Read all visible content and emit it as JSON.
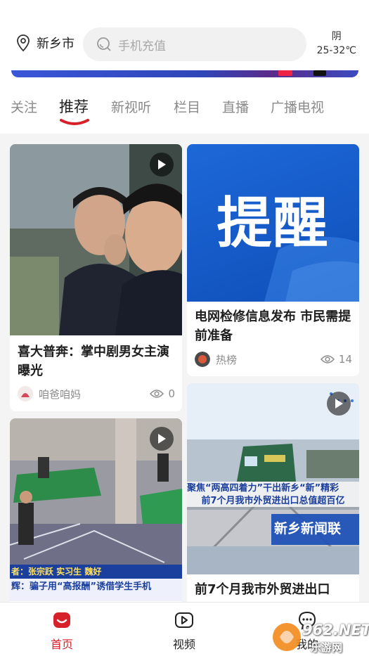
{
  "header": {
    "location": "新乡市",
    "search_placeholder": "手机充值",
    "weather_condition": "阴",
    "weather_temp": "25-32℃"
  },
  "tabs": [
    {
      "label": "关注",
      "active": false
    },
    {
      "label": "推荐",
      "active": true
    },
    {
      "label": "新视听",
      "active": false
    },
    {
      "label": "栏目",
      "active": false
    },
    {
      "label": "直播",
      "active": false
    },
    {
      "label": "广播电视",
      "active": false
    }
  ],
  "feed": {
    "cards": [
      {
        "title": "喜大普奔：掌中剧男女主演曝光",
        "author": "咱爸咱妈",
        "views": "0",
        "has_video": true
      },
      {
        "title": "电网检修信息发布 市民需提前准备",
        "author": "热榜",
        "views": "14",
        "image_text": "提醒",
        "has_video": false
      },
      {
        "title": "前7个月我市外贸进出口",
        "image_caption_1": "聚焦“两高四着力”干出新乡“新”精彩",
        "image_caption_2": "前7个月我市外贸进出口总值超百亿",
        "image_logo": "新乡新闻联",
        "has_video": true
      },
      {
        "image_caption_1": "者：张宗跃 实习生 魏好",
        "image_caption_2": "辉：骗子用“高报酬”诱借学生手机",
        "has_video": true
      }
    ]
  },
  "bottom_nav": [
    {
      "label": "首页",
      "active": true
    },
    {
      "label": "视频",
      "active": false
    },
    {
      "label": "我的",
      "active": false
    }
  ],
  "watermark": {
    "text1": "962.NET",
    "text2": "乐游网"
  },
  "colors": {
    "accent": "#d6202a"
  }
}
